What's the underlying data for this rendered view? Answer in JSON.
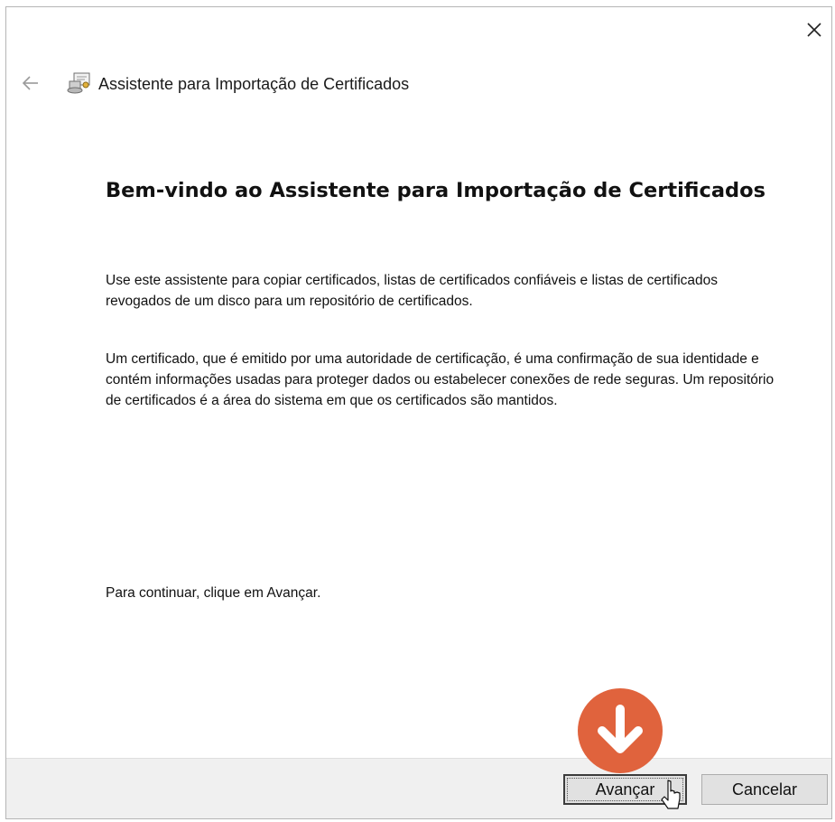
{
  "window": {
    "close_icon": "close-icon",
    "back_icon": "back-arrow-icon",
    "wizard_icon": "certificate-wizard-icon",
    "title": "Assistente para Importação de Certificados"
  },
  "main": {
    "heading": "Bem-vindo ao Assistente para Importação de Certificados",
    "paragraph1": "Use este assistente para copiar certificados, listas de certificados confiáveis e listas de certificados revogados de um disco para um repositório de certificados.",
    "paragraph2": "Um certificado, que é emitido por uma autoridade de certificação, é uma confirmação de sua identidade e contém informações usadas para proteger dados ou estabelecer conexões de rede seguras. Um repositório de certificados é a área do sistema em que os certificados são mantidos.",
    "paragraph3": "Para continuar, clique em Avançar."
  },
  "footer": {
    "next_label": "Avançar",
    "cancel_label": "Cancelar"
  },
  "overlay": {
    "badge_icon": "down-arrow-icon",
    "badge_color": "#e0633d",
    "cursor_icon": "mouse-cursor-icon"
  }
}
